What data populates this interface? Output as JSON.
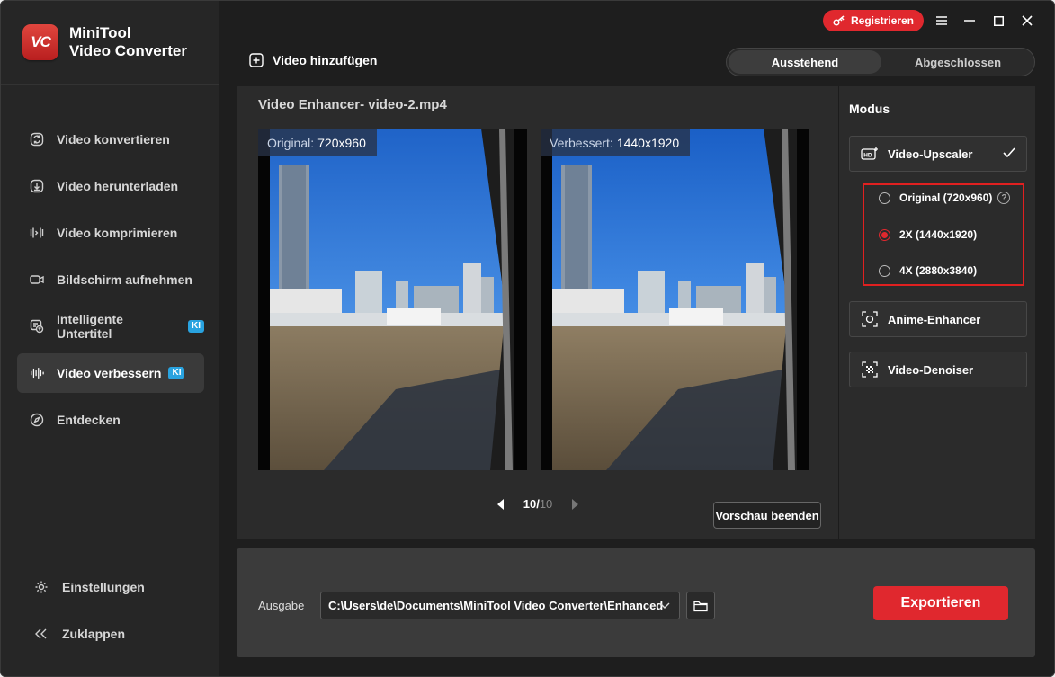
{
  "app": {
    "name_line1": "MiniTool",
    "name_line2": "Video Converter",
    "logo_text": "VC"
  },
  "topbar": {
    "register_label": "Registrieren"
  },
  "sidebar": {
    "items": [
      {
        "label": "Video konvertieren",
        "icon": "convert-icon"
      },
      {
        "label": "Video herunterladen",
        "icon": "download-icon"
      },
      {
        "label": "Video komprimieren",
        "icon": "compress-icon"
      },
      {
        "label": "Bildschirm aufnehmen",
        "icon": "record-icon"
      },
      {
        "label": "Intelligente Untertitel",
        "icon": "subtitle-icon",
        "badge": "KI"
      },
      {
        "label": "Video verbessern",
        "icon": "enhance-icon",
        "badge": "KI",
        "active": true
      },
      {
        "label": "Entdecken",
        "icon": "compass-icon"
      }
    ],
    "settings_label": "Einstellungen",
    "collapse_label": "Zuklappen"
  },
  "toolbar": {
    "add_video_label": "Video hinzufügen"
  },
  "tabs": {
    "pending": "Ausstehend",
    "done": "Abgeschlossen"
  },
  "enhancer": {
    "title": "Video Enhancer- video-2.mp4",
    "original_key": "Original:",
    "original_value": "720x960",
    "enhanced_key": "Verbessert:",
    "enhanced_value": "1440x1920",
    "page_current": "10",
    "page_sep": "/",
    "page_total": "10",
    "stop_preview_label": "Vorschau beenden"
  },
  "mode": {
    "label": "Modus",
    "upscaler": "Video-Upscaler",
    "options": [
      {
        "label": "Original (720x960)",
        "selected": false
      },
      {
        "label": "2X (1440x1920)",
        "selected": true
      },
      {
        "label": "4X (2880x3840)",
        "selected": false
      }
    ],
    "help": "?",
    "anime": "Anime-Enhancer",
    "denoiser": "Video-Denoiser"
  },
  "output": {
    "label": "Ausgabe",
    "path": "C:\\Users\\de\\Documents\\MiniTool Video Converter\\Enhanced",
    "export_label": "Exportieren"
  },
  "colors": {
    "accent": "#e0282e",
    "ki_badge": "#29a3e0",
    "sidebar": "#262626",
    "panel": "#2b2b2b"
  }
}
